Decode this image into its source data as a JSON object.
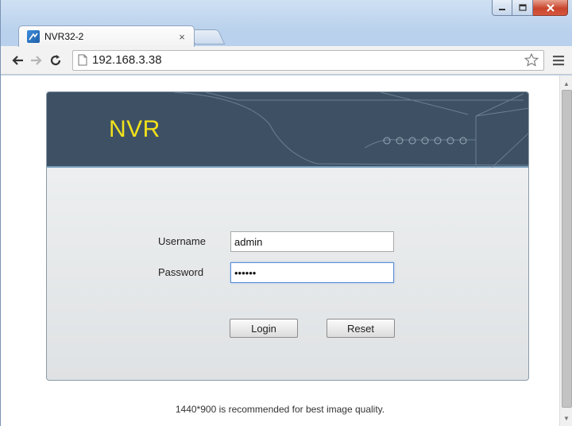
{
  "browser": {
    "tab_title": "NVR32-2",
    "tab_close": "×",
    "url": "192.168.3.38"
  },
  "page": {
    "brand": "NVR",
    "username_label": "Username",
    "username_value": "admin",
    "password_label": "Password",
    "password_value": "••••••",
    "login_label": "Login",
    "reset_label": "Reset",
    "footnote": "1440*900 is recommended for best image quality."
  },
  "colors": {
    "header_bg": "#3e5164",
    "brand_text": "#f2e21b",
    "panel_bg": "#e8eaec"
  }
}
